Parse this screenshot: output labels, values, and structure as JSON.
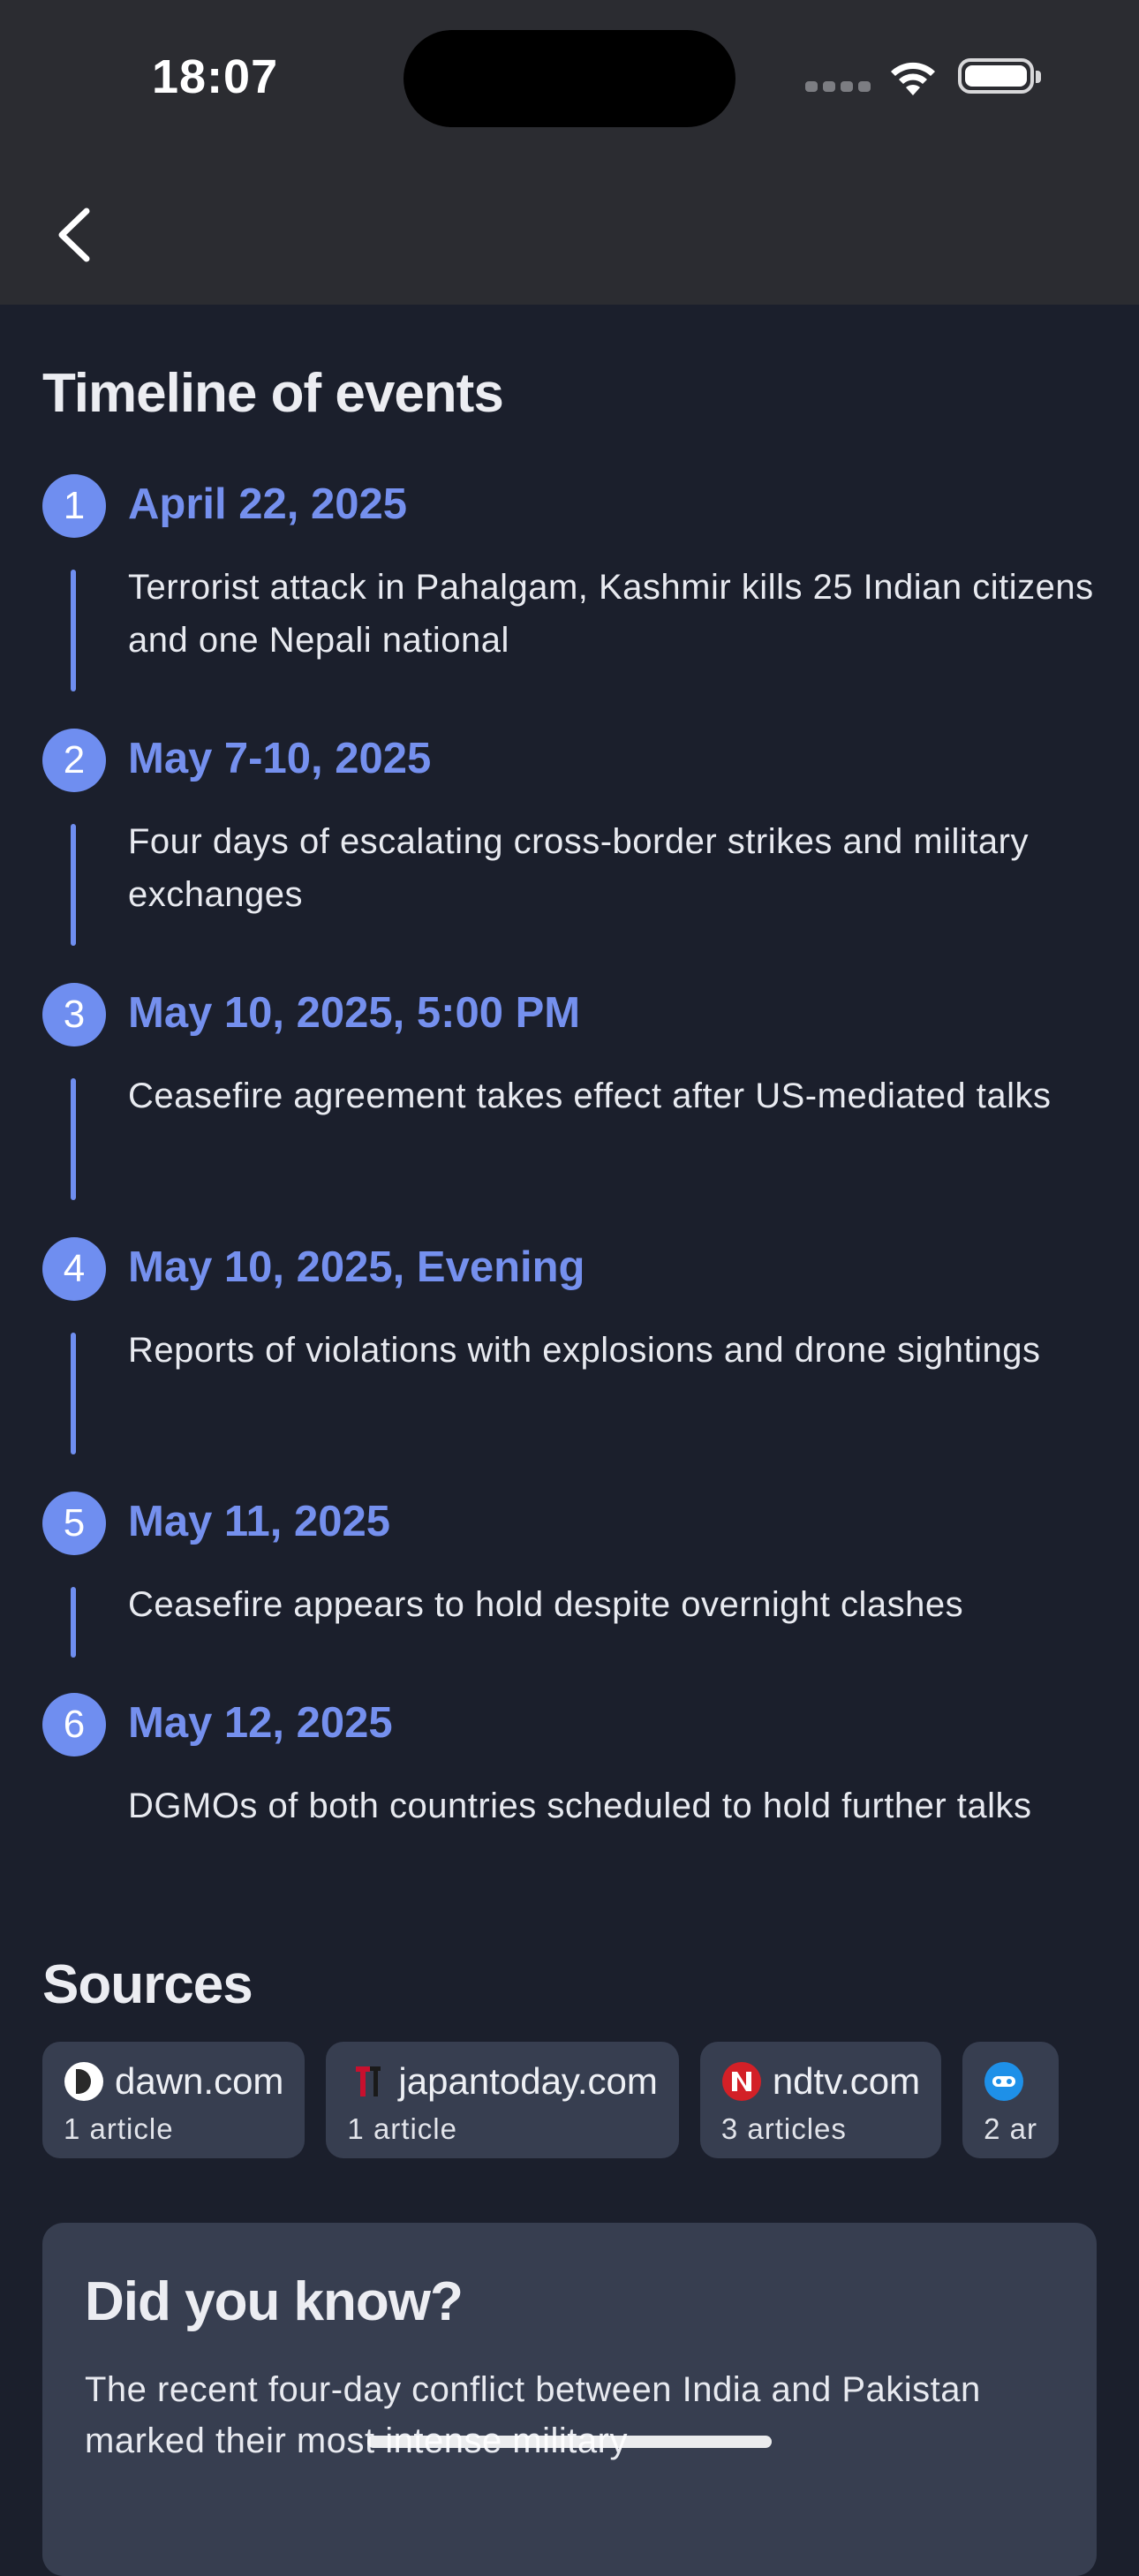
{
  "status": {
    "time": "18:07"
  },
  "timeline": {
    "title": "Timeline of events",
    "items": [
      {
        "num": "1",
        "date": "April 22, 2025",
        "text": "Terrorist attack in Pahalgam, Kashmir kills 25 Indian citizens and one Nepali national"
      },
      {
        "num": "2",
        "date": "May 7-10, 2025",
        "text": "Four days of escalating cross-border strikes and military exchanges"
      },
      {
        "num": "3",
        "date": "May 10, 2025, 5:00 PM",
        "text": "Ceasefire agreement takes effect after US-mediated talks"
      },
      {
        "num": "4",
        "date": "May 10, 2025, Evening",
        "text": "Reports of violations with explosions and drone sightings"
      },
      {
        "num": "5",
        "date": "May 11, 2025",
        "text": "Ceasefire appears to hold despite overnight clashes"
      },
      {
        "num": "6",
        "date": "May 12, 2025",
        "text": "DGMOs of both countries scheduled to hold further talks"
      }
    ]
  },
  "sources": {
    "title": "Sources",
    "items": [
      {
        "domain": "dawn.com",
        "count": "1 article"
      },
      {
        "domain": "japantoday.com",
        "count": "1 article"
      },
      {
        "domain": "ndtv.com",
        "count": "3 articles"
      },
      {
        "domain": "",
        "count": "2 ar"
      }
    ]
  },
  "did_you_know": {
    "title": "Did you know?",
    "text": "The recent four-day conflict between India and Pakistan marked their most intense military"
  }
}
